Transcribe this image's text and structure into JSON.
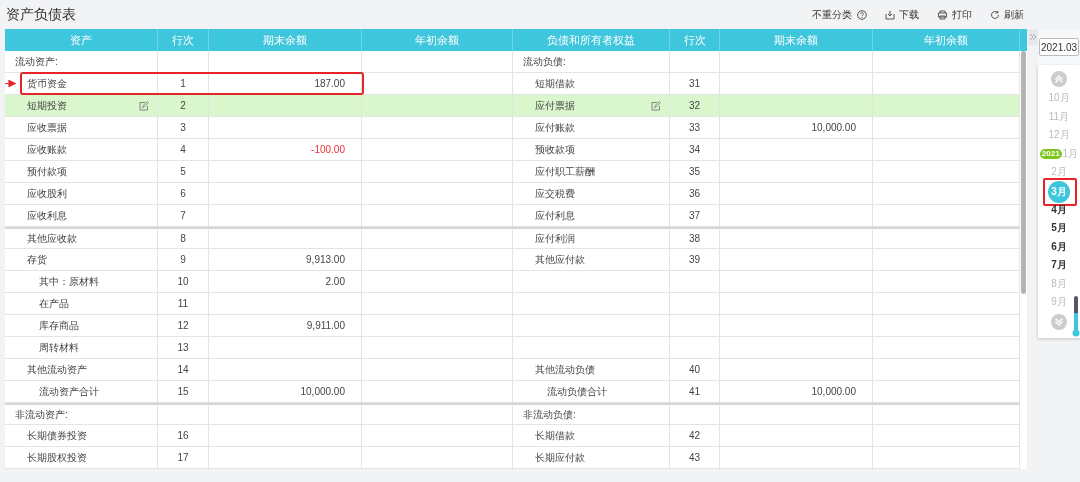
{
  "title": "资产负债表",
  "toolbar": {
    "toggle": {
      "label": "不重分类",
      "checked": false
    },
    "actions": [
      {
        "kind": "download",
        "label": "下载"
      },
      {
        "kind": "print",
        "label": "打印"
      },
      {
        "kind": "refresh",
        "label": "刷新"
      }
    ]
  },
  "table": {
    "columns": [
      "资产",
      "行次",
      "期末余额",
      "年初余额",
      "负债和所有者权益",
      "行次",
      "期末余额",
      "年初余额"
    ],
    "rows": [
      {
        "selected": false,
        "callout": false,
        "group_start": false,
        "left": {
          "kind": "section",
          "label": "流动资产:"
        },
        "right": {
          "kind": "section",
          "label": "流动负债:"
        }
      },
      {
        "selected": false,
        "callout": true,
        "group_start": false,
        "left": {
          "kind": "item",
          "label": "货币资金",
          "line": "1",
          "end": "187.00",
          "negative": false
        },
        "right": {
          "kind": "item",
          "label": "短期借款",
          "line": "31"
        }
      },
      {
        "selected": true,
        "callout": false,
        "group_start": false,
        "left": {
          "kind": "item",
          "label": "短期投资",
          "line": "2"
        },
        "right": {
          "kind": "item",
          "label": "应付票据",
          "line": "32"
        }
      },
      {
        "selected": false,
        "callout": false,
        "group_start": false,
        "left": {
          "kind": "item",
          "label": "应收票据",
          "line": "3"
        },
        "right": {
          "kind": "item",
          "label": "应付账款",
          "line": "33",
          "end": "10,000.00",
          "negative": false
        }
      },
      {
        "selected": false,
        "callout": false,
        "group_start": false,
        "left": {
          "kind": "item",
          "label": "应收账款",
          "line": "4",
          "end": "-100.00",
          "negative": true
        },
        "right": {
          "kind": "item",
          "label": "预收款项",
          "line": "34"
        }
      },
      {
        "selected": false,
        "callout": false,
        "group_start": false,
        "left": {
          "kind": "item",
          "label": "预付款项",
          "line": "5"
        },
        "right": {
          "kind": "item",
          "label": "应付职工薪酬",
          "line": "35"
        }
      },
      {
        "selected": false,
        "callout": false,
        "group_start": false,
        "left": {
          "kind": "item",
          "label": "应收股利",
          "line": "6"
        },
        "right": {
          "kind": "item",
          "label": "应交税费",
          "line": "36"
        }
      },
      {
        "selected": false,
        "callout": false,
        "group_start": false,
        "left": {
          "kind": "item",
          "label": "应收利息",
          "line": "7"
        },
        "right": {
          "kind": "item",
          "label": "应付利息",
          "line": "37"
        }
      },
      {
        "selected": false,
        "callout": false,
        "group_start": true,
        "left": {
          "kind": "item",
          "label": "其他应收款",
          "line": "8"
        },
        "right": {
          "kind": "item",
          "label": "应付利润",
          "line": "38"
        }
      },
      {
        "selected": false,
        "callout": false,
        "group_start": false,
        "left": {
          "kind": "item",
          "label": "存货",
          "line": "9",
          "end": "9,913.00",
          "negative": false
        },
        "right": {
          "kind": "item",
          "label": "其他应付款",
          "line": "39"
        }
      },
      {
        "selected": false,
        "callout": false,
        "group_start": false,
        "left": {
          "kind": "subitem",
          "label": "其中：原材料",
          "line": "10",
          "end": "2.00",
          "negative": false
        },
        "right": {
          "kind": "empty"
        }
      },
      {
        "selected": false,
        "callout": false,
        "group_start": false,
        "left": {
          "kind": "subitem",
          "label": "在产品",
          "line": "11"
        },
        "right": {
          "kind": "empty"
        }
      },
      {
        "selected": false,
        "callout": false,
        "group_start": false,
        "left": {
          "kind": "subitem",
          "label": "库存商品",
          "line": "12",
          "end": "9,911.00",
          "negative": false
        },
        "right": {
          "kind": "empty"
        }
      },
      {
        "selected": false,
        "callout": false,
        "group_start": false,
        "left": {
          "kind": "subitem",
          "label": "周转材料",
          "line": "13"
        },
        "right": {
          "kind": "empty"
        }
      },
      {
        "selected": false,
        "callout": false,
        "group_start": false,
        "left": {
          "kind": "item",
          "label": "其他流动资产",
          "line": "14"
        },
        "right": {
          "kind": "item",
          "label": "其他流动负债",
          "line": "40"
        }
      },
      {
        "selected": false,
        "callout": false,
        "group_start": false,
        "left": {
          "kind": "subitem",
          "label": "流动资产合计",
          "line": "15",
          "end": "10,000.00",
          "negative": false
        },
        "right": {
          "kind": "subitem",
          "label": "流动负债合计",
          "line": "41",
          "end": "10,000.00",
          "negative": false
        }
      },
      {
        "selected": false,
        "callout": false,
        "group_start": true,
        "left": {
          "kind": "section",
          "label": "非流动资产:"
        },
        "right": {
          "kind": "section",
          "label": "非流动负债:"
        }
      },
      {
        "selected": false,
        "callout": false,
        "group_start": false,
        "left": {
          "kind": "item",
          "label": "长期债券投资",
          "line": "16"
        },
        "right": {
          "kind": "item",
          "label": "长期借款",
          "line": "42"
        }
      },
      {
        "selected": false,
        "callout": false,
        "group_start": false,
        "left": {
          "kind": "item",
          "label": "长期股权投资",
          "line": "17"
        },
        "right": {
          "kind": "item",
          "label": "长期应付款",
          "line": "43"
        }
      }
    ]
  },
  "period": {
    "value": "2021.03",
    "slider": {
      "level": 0.55
    },
    "months": [
      {
        "label": "10月",
        "disabled": true,
        "selected": false,
        "callout": false
      },
      {
        "label": "11月",
        "disabled": true,
        "selected": false,
        "callout": false
      },
      {
        "label": "12月",
        "disabled": true,
        "selected": false,
        "callout": false
      },
      {
        "label": "1月",
        "disabled": true,
        "selected": false,
        "callout": false,
        "year_badge": "2021"
      },
      {
        "label": "2月",
        "disabled": true,
        "selected": false,
        "callout": false
      },
      {
        "label": "3月",
        "disabled": false,
        "selected": true,
        "callout": true
      },
      {
        "label": "4月",
        "disabled": false,
        "selected": false,
        "callout": false
      },
      {
        "label": "5月",
        "disabled": false,
        "selected": false,
        "callout": false
      },
      {
        "label": "6月",
        "disabled": false,
        "selected": false,
        "callout": false
      },
      {
        "label": "7月",
        "disabled": false,
        "selected": false,
        "callout": false
      },
      {
        "label": "8月",
        "disabled": true,
        "selected": false,
        "callout": false
      },
      {
        "label": "9月",
        "disabled": true,
        "selected": false,
        "callout": false
      }
    ]
  }
}
